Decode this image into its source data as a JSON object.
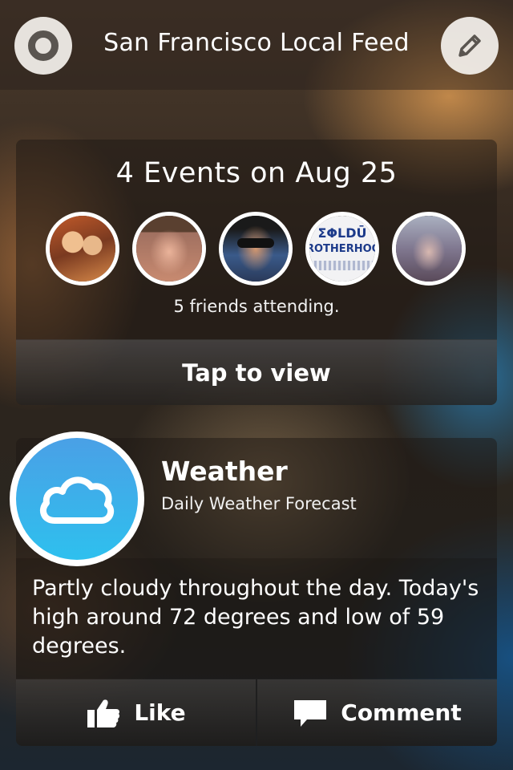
{
  "header": {
    "title": "San Francisco Local Feed"
  },
  "events": {
    "title": "4 Events on Aug 25",
    "friends_text": "5 friends attending.",
    "tap_label": "Tap to view",
    "avatar4_text1": "ΣΦLDŪ",
    "avatar4_text2": "ROTHERHOO"
  },
  "weather": {
    "title": "Weather",
    "subtitle": "Daily Weather Forecast",
    "description": "Partly cloudy throughout the day. Today's high around 72 degrees and low of 59 degrees.",
    "like_label": "Like",
    "comment_label": "Comment"
  },
  "colors": {
    "weather_icon_top": "#4aa0e6",
    "weather_icon_bottom": "#2ec0ee"
  }
}
